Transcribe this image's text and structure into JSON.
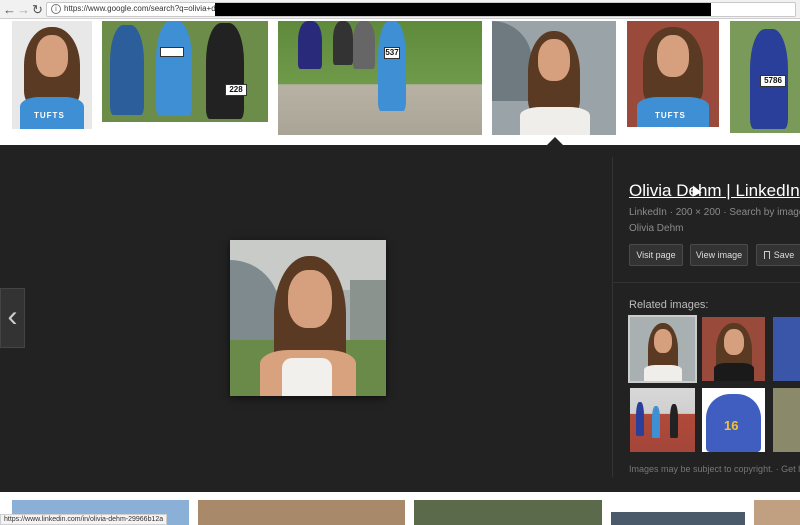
{
  "browser": {
    "url": "https://www.google.com/search?q=olivia+dehm",
    "back_icon": "back-arrow-icon",
    "forward_icon": "forward-arrow-icon",
    "reload_icon": "reload-icon"
  },
  "thumbnails": [
    {
      "shirt_text": "TUFTS",
      "bib": ""
    },
    {
      "shirt_text": "",
      "bib": "228"
    },
    {
      "shirt_text": "",
      "bib": "537"
    },
    {
      "shirt_text": "",
      "bib": ""
    },
    {
      "shirt_text": "TUFTS",
      "bib": ""
    },
    {
      "shirt_text": "",
      "bib": "5786"
    }
  ],
  "viewer": {
    "prev_glyph": "‹",
    "title": "Olivia Dehm | LinkedIn",
    "meta": "LinkedIn  ·  200 × 200  ·  Search by image",
    "source_name": "Olivia Dehm",
    "buttons": {
      "visit": "Visit page",
      "view": "View image",
      "save": "Save"
    },
    "related_label": "Related images:",
    "related_jersey": "16",
    "copyright": "Images may be subject to copyright.  ·  Get help"
  },
  "status_bar": {
    "url": "https://www.linkedin.com/in/olivia-dehm-29966b12a"
  },
  "colors": {
    "panel_bg": "#222222",
    "tufts_blue": "#3f8fd4",
    "hair_brown": "#5a3a22"
  }
}
